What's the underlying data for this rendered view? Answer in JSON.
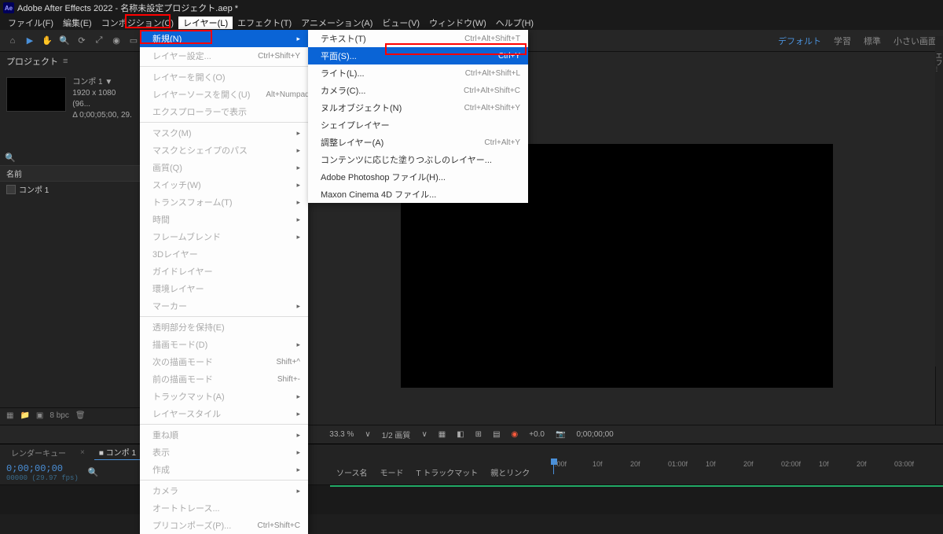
{
  "titlebar": {
    "app": "Adobe After Effects 2022",
    "project": "名称未設定プロジェクト.aep *"
  },
  "menubar": {
    "items": [
      "ファイル(F)",
      "編集(E)",
      "コンポジション(C)",
      "レイヤー(L)",
      "エフェクト(T)",
      "アニメーション(A)",
      "ビュー(V)",
      "ウィンドウ(W)",
      "ヘルプ(H)"
    ]
  },
  "workspace_tabs": [
    "デフォルト",
    "学習",
    "標準",
    "小さい画面"
  ],
  "project_panel": {
    "tab": "プロジェクト",
    "comp_name": "コンポ 1 ▼",
    "dims": "1920 x 1080 (96...",
    "duration": "Δ 0;00;05;00, 29.",
    "col_header": "名前",
    "item": "コンポ 1"
  },
  "dropdown_main": [
    {
      "label": "新規(N)",
      "selected": true,
      "arrow": true
    },
    {
      "label": "レイヤー設定...",
      "shortcut": "Ctrl+Shift+Y",
      "disabled": true
    },
    {
      "sep": true
    },
    {
      "label": "レイヤーを開く(O)",
      "disabled": true
    },
    {
      "label": "レイヤーソースを開く(U)",
      "shortcut": "Alt+Numpad Enter",
      "disabled": true
    },
    {
      "label": "エクスプローラーで表示",
      "disabled": true
    },
    {
      "sep": true
    },
    {
      "label": "マスク(M)",
      "arrow": true,
      "disabled": true
    },
    {
      "label": "マスクとシェイプのパス",
      "arrow": true,
      "disabled": true
    },
    {
      "label": "画質(Q)",
      "arrow": true,
      "disabled": true
    },
    {
      "label": "スイッチ(W)",
      "arrow": true,
      "disabled": true
    },
    {
      "label": "トランスフォーム(T)",
      "arrow": true,
      "disabled": true
    },
    {
      "label": "時間",
      "arrow": true,
      "disabled": true
    },
    {
      "label": "フレームブレンド",
      "arrow": true,
      "disabled": true
    },
    {
      "label": "3Dレイヤー",
      "disabled": true
    },
    {
      "label": "ガイドレイヤー",
      "disabled": true
    },
    {
      "label": "環境レイヤー",
      "disabled": true
    },
    {
      "label": "マーカー",
      "arrow": true,
      "disabled": true
    },
    {
      "sep": true
    },
    {
      "label": "透明部分を保持(E)",
      "disabled": true
    },
    {
      "label": "描画モード(D)",
      "arrow": true,
      "disabled": true
    },
    {
      "label": "次の描画モード",
      "shortcut": "Shift+^",
      "disabled": true
    },
    {
      "label": "前の描画モード",
      "shortcut": "Shift+-",
      "disabled": true
    },
    {
      "label": "トラックマット(A)",
      "arrow": true,
      "disabled": true
    },
    {
      "label": "レイヤースタイル",
      "arrow": true,
      "disabled": true
    },
    {
      "sep": true
    },
    {
      "label": "重ね順",
      "arrow": true,
      "disabled": true
    },
    {
      "label": "表示",
      "arrow": true,
      "disabled": true
    },
    {
      "label": "作成",
      "arrow": true,
      "disabled": true
    },
    {
      "sep": true
    },
    {
      "label": "カメラ",
      "arrow": true,
      "disabled": true
    },
    {
      "label": "オートトレース...",
      "disabled": true
    },
    {
      "label": "プリコンポーズ(P)...",
      "shortcut": "Ctrl+Shift+C",
      "disabled": true
    }
  ],
  "dropdown_sub": [
    {
      "label": "テキスト(T)",
      "shortcut": "Ctrl+Alt+Shift+T"
    },
    {
      "label": "平面(S)...",
      "shortcut": "Ctrl+Y",
      "selected": true
    },
    {
      "label": "ライト(L)...",
      "shortcut": "Ctrl+Alt+Shift+L"
    },
    {
      "label": "カメラ(C)...",
      "shortcut": "Ctrl+Alt+Shift+C"
    },
    {
      "label": "ヌルオブジェクト(N)",
      "shortcut": "Ctrl+Alt+Shift+Y"
    },
    {
      "label": "シェイプレイヤー"
    },
    {
      "label": "調整レイヤー(A)",
      "shortcut": "Ctrl+Alt+Y"
    },
    {
      "label": "コンテンツに応じた塗りつぶしのレイヤー..."
    },
    {
      "label": "Adobe Photoshop ファイル(H)..."
    },
    {
      "label": "Maxon Cinema 4D ファイル..."
    }
  ],
  "viewer": {
    "zoom": "33.3 %",
    "quality": "1/2 画質",
    "exposure": "+0.0",
    "timecode": "0;00;00;00"
  },
  "timeline": {
    "tab_render": "レンダーキュー",
    "tab_comp": "コンポ 1",
    "timecode": "0;00;00;00",
    "fps": "00000 (29.97 fps)",
    "col_source": "ソース名",
    "col_mode": "モード",
    "col_track": "T トラックマット",
    "col_parent": "親とリンク",
    "ticks": [
      ":00f",
      "10f",
      "20f",
      "01:00f",
      "10f",
      "20f",
      "02:00f",
      "10f",
      "20f",
      "03:00f"
    ]
  },
  "footer": {
    "bpc": "8 bpc"
  },
  "effects_panel": {
    "tab": "エフ..."
  }
}
